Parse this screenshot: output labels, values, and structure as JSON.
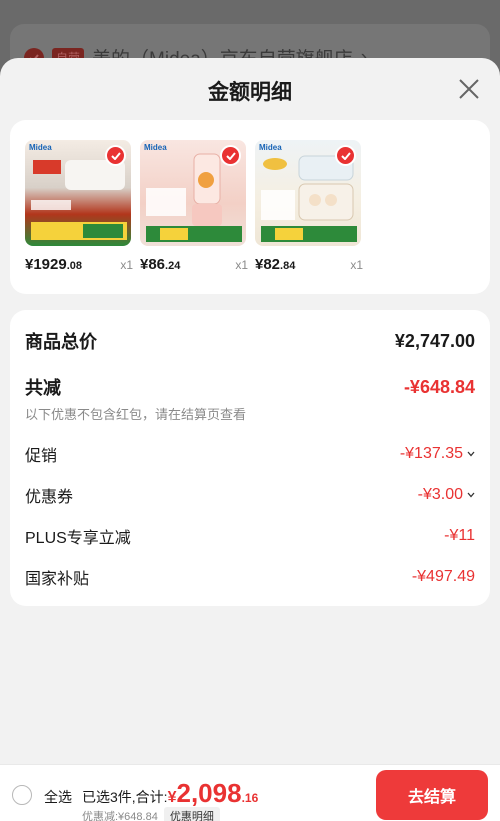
{
  "background": {
    "store_badge": "自营",
    "store_name": "美的（Midea）京东自营旗舰店",
    "store_arrow": "›"
  },
  "sheet": {
    "title": "金额明细"
  },
  "products": [
    {
      "brand": "Midea",
      "price_int": "¥1929",
      "price_dec": ".08",
      "qty": "x1"
    },
    {
      "brand": "Midea",
      "price_int": "¥86",
      "price_dec": ".24",
      "qty": "x1"
    },
    {
      "brand": "Midea",
      "price_int": "¥82",
      "price_dec": ".84",
      "qty": "x1"
    }
  ],
  "summary": {
    "subtotal_label": "商品总价",
    "subtotal_value": "¥2,747.00",
    "total_discount_label": "共减",
    "total_discount_value": "-¥648.84",
    "note": "以下优惠不包含红包，请在结算页查看",
    "rows": [
      {
        "label": "促销",
        "value": "-¥137.35"
      },
      {
        "label": "优惠券",
        "value": "-¥3.00"
      },
      {
        "label": "PLUS专享立减",
        "value": "-¥11"
      },
      {
        "label": "国家补贴",
        "value": "-¥497.49"
      }
    ]
  },
  "bottom": {
    "select_all": "全选",
    "selected_prefix": "已选3件,合计:",
    "currency": "¥",
    "total_int": "2,098",
    "total_dec": ".16",
    "discount_text": "优惠减:¥648.84",
    "detail_label": "优惠明细",
    "checkout_label": "去结算"
  },
  "colors": {
    "accent_red": "#e93232",
    "sheet_bg": "#f2f2f2",
    "card_bg": "#ffffff"
  },
  "icons": [
    "close-icon",
    "check-icon",
    "chevron-down-icon",
    "radio-icon"
  ]
}
